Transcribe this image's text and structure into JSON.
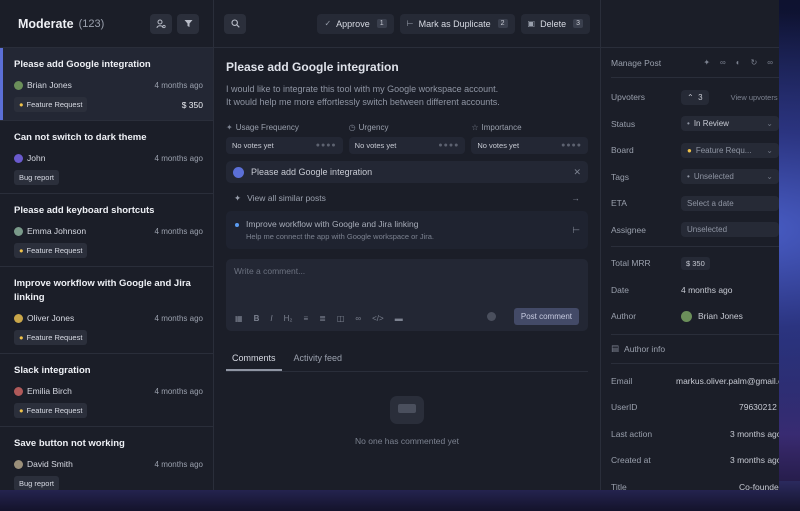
{
  "left": {
    "title": "Moderate",
    "count": "(123)",
    "posts": [
      {
        "title": "Please add Google integration",
        "author": "Brian Jones",
        "time": "4 months ago",
        "tag": "Feature Request",
        "tag_icon": "bulb-icon",
        "mrr": "$ 350",
        "avatar_color": "#6b8f5a"
      },
      {
        "title": "Can not switch to dark theme",
        "author": "John",
        "time": "4 months ago",
        "tag": "Bug report",
        "tag_icon": "",
        "mrr": "",
        "avatar_color": "#6a5acd"
      },
      {
        "title": "Please add keyboard shortcuts",
        "author": "Emma Johnson",
        "time": "4 months ago",
        "tag": "Feature Request",
        "tag_icon": "bulb-icon",
        "mrr": "",
        "avatar_color": "#7a9a8a"
      },
      {
        "title": "Improve workflow with Google and Jira linking",
        "author": "Oliver Jones",
        "time": "4 months ago",
        "tag": "Feature Request",
        "tag_icon": "bulb-icon",
        "mrr": "",
        "avatar_color": "#c9a64a"
      },
      {
        "title": "Slack integration",
        "author": "Emilia Birch",
        "time": "4 months ago",
        "tag": "Feature Request",
        "tag_icon": "bulb-icon",
        "mrr": "",
        "avatar_color": "#b05a5a"
      },
      {
        "title": "Save button not working",
        "author": "David Smith",
        "time": "4 months ago",
        "tag": "Bug report",
        "tag_icon": "",
        "mrr": "",
        "avatar_color": "#9a8f7a"
      }
    ]
  },
  "header": {
    "approve": "Approve",
    "approve_key": "1",
    "duplicate": "Mark as Duplicate",
    "duplicate_key": "2",
    "delete": "Delete",
    "delete_key": "3"
  },
  "post": {
    "title": "Please add Google integration",
    "desc1": "I would like to integrate this tool with my Google workspace account.",
    "desc2": "It would help me more effortlessly switch between different accounts.",
    "metrics": [
      {
        "label": "Usage Frequency",
        "value": "No votes yet"
      },
      {
        "label": "Urgency",
        "value": "No votes yet"
      },
      {
        "label": "Importance",
        "value": "No votes yet"
      }
    ],
    "similar_title": "Please add Google integration",
    "all_similar": "View all similar posts",
    "linked_title": "Improve workflow with Google and Jira linking",
    "linked_desc": "Help me connect the app with Google workspace or Jira.",
    "comment_placeholder": "Write a comment...",
    "post_comment": "Post comment",
    "tabs": [
      "Comments",
      "Activity feed"
    ],
    "empty": "No one has commented yet"
  },
  "sidebar": {
    "manage": "Manage Post",
    "upvoters_label": "Upvoters",
    "upvoters": "3",
    "view_upvoters": "View upvoters",
    "status_label": "Status",
    "status": "In Review",
    "board_label": "Board",
    "board": "Feature Requ...",
    "tags_label": "Tags",
    "tags": "Unselected",
    "eta_label": "ETA",
    "eta": "Select a date",
    "assignee_label": "Assignee",
    "assignee": "Unselected",
    "mrr_label": "Total MRR",
    "mrr": "$ 350",
    "date_label": "Date",
    "date": "4 months ago",
    "author_label": "Author",
    "author": "Brian Jones",
    "author_info": "Author info",
    "email_label": "Email",
    "email": "markus.oliver.palm@gmail.com",
    "userid_label": "UserID",
    "userid": "79630212",
    "last_action_label": "Last action",
    "last_action": "3 months ago",
    "created_label": "Created at",
    "created": "3 months ago",
    "title_label": "Title",
    "title": "Co-founder"
  }
}
